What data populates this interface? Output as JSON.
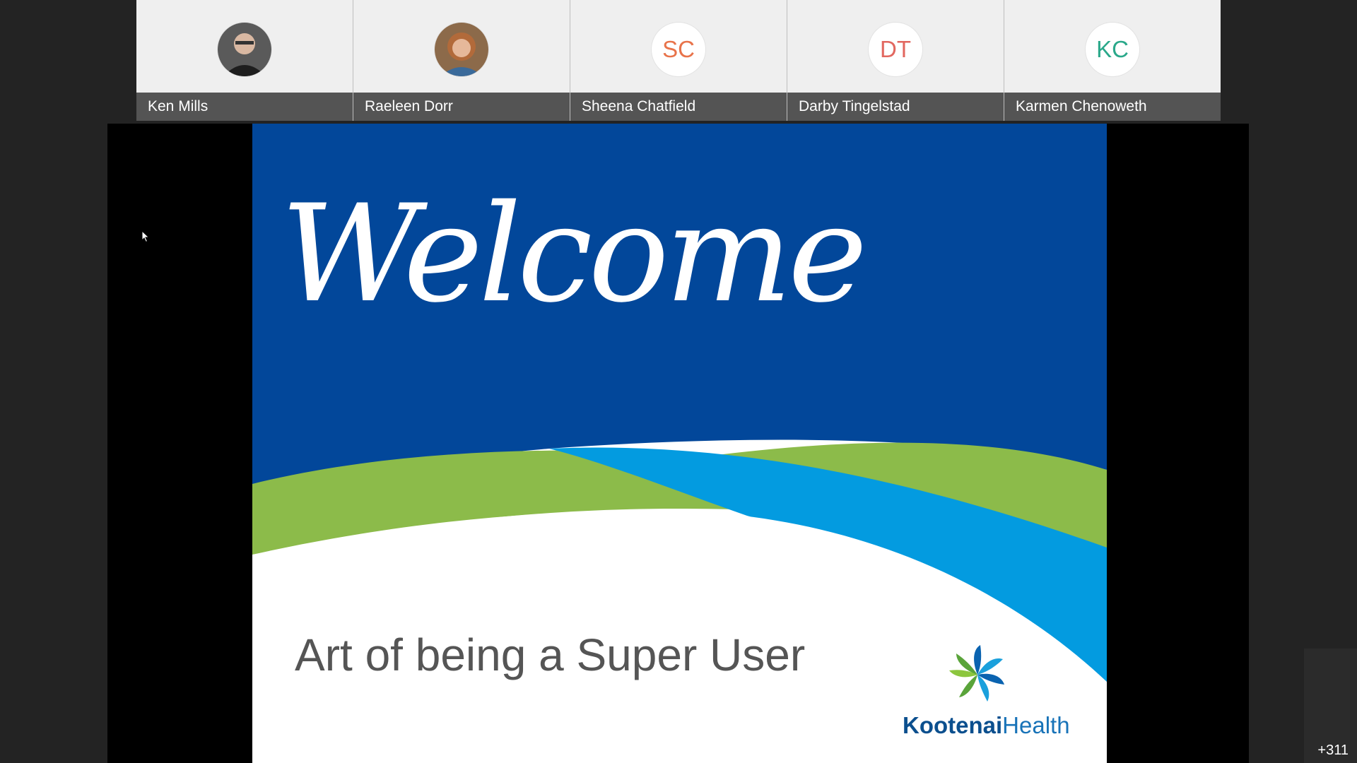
{
  "participants": [
    {
      "name": "Ken Mills",
      "initials": "",
      "avatar_type": "photo",
      "avatar_icon": "person-photo-icon"
    },
    {
      "name": "Raeleen Dorr",
      "initials": "",
      "avatar_type": "photo",
      "avatar_icon": "person-photo-icon"
    },
    {
      "name": "Sheena Chatfield",
      "initials": "SC",
      "avatar_type": "initials",
      "color": "#e8734a"
    },
    {
      "name": "Darby Tingelstad",
      "initials": "DT",
      "avatar_type": "initials",
      "color": "#e2675f"
    },
    {
      "name": "Karmen Chenoweth",
      "initials": "KC",
      "avatar_type": "initials",
      "color": "#2aa88a"
    }
  ],
  "slide": {
    "title": "Welcome",
    "subtitle": "Art of being a Super User",
    "logo": {
      "word1": "Kootenai",
      "word2": "Health"
    },
    "colors": {
      "blue": "#02479a",
      "green": "#8cbb4a",
      "cyan": "#039be0"
    }
  },
  "overflow_count": "+311"
}
